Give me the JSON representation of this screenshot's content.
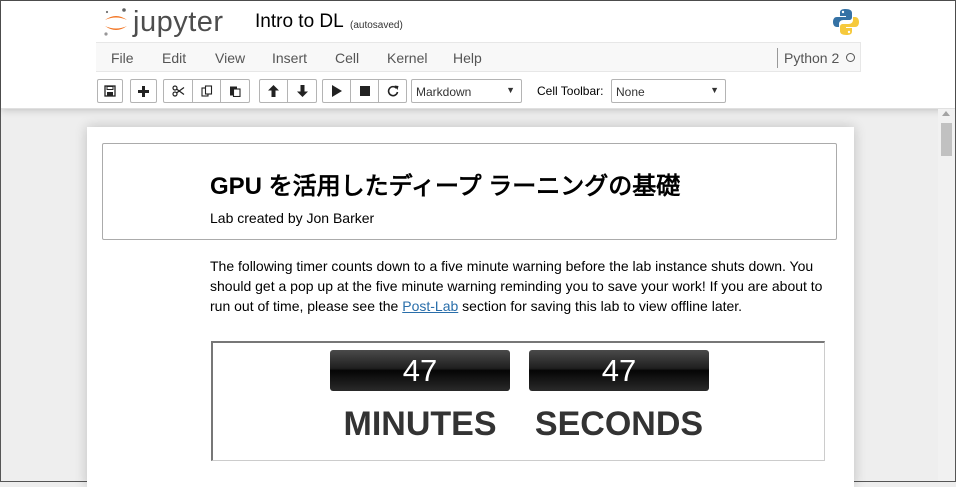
{
  "header": {
    "logo_text": "jupyter",
    "notebook_name": "Intro to DL",
    "autosave_status": "(autosaved)",
    "python_logo_icon": "python-logo-icon"
  },
  "menubar": {
    "items": [
      "File",
      "Edit",
      "View",
      "Insert",
      "Cell",
      "Kernel",
      "Help"
    ],
    "kernel_name": "Python 2",
    "kernel_status_icon": "kernel-idle-circle-icon"
  },
  "toolbar": {
    "icons": [
      "save-icon",
      "plus-icon",
      "scissors-icon",
      "copy-icon",
      "paste-icon",
      "arrow-up-icon",
      "arrow-down-icon",
      "play-icon",
      "stop-icon",
      "restart-icon"
    ],
    "cell_type": "Markdown",
    "cell_toolbar_label": "Cell Toolbar:",
    "cell_toolbar_value": "None"
  },
  "notebook": {
    "title": "GPU を活用したディープ ラーニングの基礎",
    "author": "Lab created by Jon Barker",
    "intro_before_link": "The following timer counts down to a five minute warning before the lab instance shuts down. You should get a pop up at the five minute warning reminding you to save your work! If you are about to run out of time, please see the ",
    "intro_link": "Post-Lab",
    "intro_after_link": " section for saving this lab to view offline later.",
    "timer": {
      "minutes": "47",
      "seconds": "47",
      "minutes_label": "MINUTES",
      "seconds_label": "SECONDS"
    }
  },
  "colors": {
    "jupyter_orange": "#f37726",
    "link": "#296eaa",
    "timer_text": "#333333"
  }
}
